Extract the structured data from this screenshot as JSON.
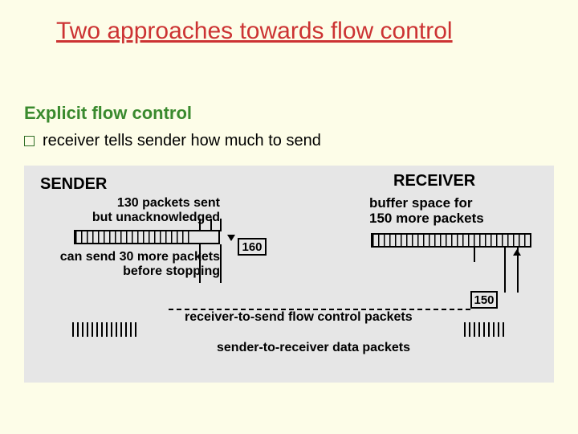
{
  "title": "Two approaches towards flow control",
  "subheading": "Explicit flow control",
  "bullet": "receiver tells sender how much to send",
  "diagram": {
    "sender_label": "SENDER",
    "receiver_label": "RECEIVER",
    "sent_label_line1": "130 packets sent",
    "sent_label_line2": "but unacknowledged",
    "buffer_label_line1": "buffer space for",
    "buffer_label_line2": "150 more packets",
    "cansend_line1": "can send 30 more packets",
    "cansend_line2": "before stopping",
    "fc_label": "receiver-to-send flow control packets",
    "data_label": "sender-to-receiver data packets",
    "box160": "160",
    "box150": "150"
  }
}
